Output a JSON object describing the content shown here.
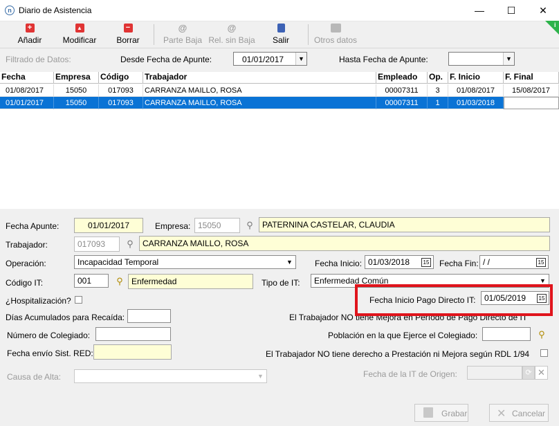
{
  "window": {
    "title": "Diario de Asistencia",
    "app_icon": "app-logo-icon",
    "minimize": "—",
    "maximize": "☐",
    "close": "✕"
  },
  "toolbar": {
    "add_label": "Añadir",
    "modify_label": "Modificar",
    "delete_label": "Borrar",
    "parte_baja_label": "Parte Baja",
    "rel_sin_baja_label": "Rel. sin Baja",
    "exit_label": "Salir",
    "otros_datos_label": "Otros datos"
  },
  "filter": {
    "label": "Filtrado de Datos:",
    "desde_label": "Desde Fecha de Apunte:",
    "desde_value": "01/01/2017",
    "hasta_label": "Hasta Fecha de Apunte:",
    "hasta_value": ""
  },
  "grid": {
    "columns": [
      "Fecha",
      "Empresa",
      "Código",
      "Trabajador",
      "Empleado",
      "Op.",
      "F. Inicio",
      "F. Final"
    ],
    "rows": [
      [
        "01/08/2017",
        "15050",
        "017093",
        "CARRANZA MAILLO, ROSA",
        "00007311",
        "3",
        "01/08/2017",
        "15/08/2017"
      ],
      [
        "01/01/2017",
        "15050",
        "017093",
        "CARRANZA MAILLO, ROSA",
        "00007311",
        "1",
        "01/03/2018",
        ""
      ]
    ]
  },
  "form": {
    "fecha_apunte_label": "Fecha Apunte:",
    "fecha_apunte_value": "01/01/2017",
    "empresa_label": "Empresa:",
    "empresa_code": "15050",
    "empresa_name": "PATERNINA CASTELAR, CLAUDIA",
    "trabajador_label": "Trabajador:",
    "trabajador_code": "017093",
    "trabajador_name": "CARRANZA MAILLO, ROSA",
    "operacion_label": "Operación:",
    "operacion_value": "Incapacidad Temporal",
    "fecha_inicio_label": "Fecha Inicio:",
    "fecha_inicio_value": "01/03/2018",
    "fecha_fin_label": "Fecha Fin:",
    "fecha_fin_value": " /  /",
    "codigo_it_label": "Código IT:",
    "codigo_it_value": "001",
    "codigo_it_desc": "Enfermedad",
    "tipo_it_label": "Tipo de IT:",
    "tipo_it_value": "Enfermedad Común",
    "hospitalizacion_label": "¿Hospitalización?",
    "fecha_pago_label": "Fecha Inicio Pago Directo IT:",
    "fecha_pago_value": "01/05/2019",
    "dias_label": "Días Acumulados para Recaída:",
    "dias_value": "",
    "no_mejora_label": "El Trabajador NO tiene Mejora en Período de Pago Directo de IT",
    "colegiado_label": "Número de Colegiado:",
    "colegiado_value": "",
    "poblacion_label": "Población en la que Ejerce el Colegiado:",
    "poblacion_value": "",
    "envio_label": "Fecha envío Sist. RED:",
    "envio_value": "",
    "no_derecho_label": "El Trabajador NO tiene derecho a Prestación ni Mejora según RDL 1/94",
    "causa_alta_label": "Causa de Alta:",
    "causa_alta_value": "",
    "fecha_origen_label": "Fecha de la IT de Origen:",
    "fecha_origen_value": ""
  },
  "footer": {
    "save_label": "Grabar",
    "cancel_label": "Cancelar"
  },
  "colors": {
    "selection": "#0a73d5",
    "highlight": "#e0141c",
    "yellow_field": "#fefed6"
  }
}
